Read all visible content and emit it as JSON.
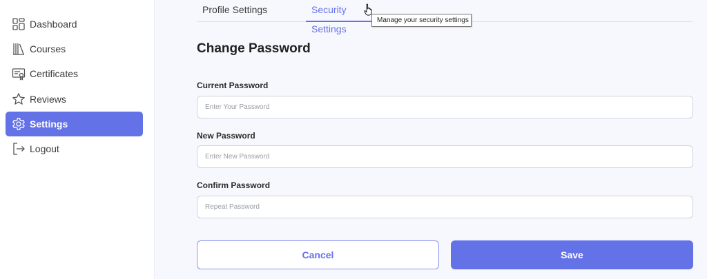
{
  "sidebar": {
    "items": [
      {
        "label": "Dashboard",
        "icon": "dashboard-icon",
        "active": false
      },
      {
        "label": "Courses",
        "icon": "books-icon",
        "active": false
      },
      {
        "label": "Certificates",
        "icon": "certificate-icon",
        "active": false
      },
      {
        "label": "Reviews",
        "icon": "star-icon",
        "active": false
      },
      {
        "label": "Settings",
        "icon": "gear-icon",
        "active": true
      },
      {
        "label": "Logout",
        "icon": "logout-icon",
        "active": false
      }
    ]
  },
  "tabs": [
    {
      "label": "Profile Settings",
      "active": false
    },
    {
      "label": "Security Settings",
      "active": true
    }
  ],
  "tooltip": "Manage your security settings",
  "form": {
    "title": "Change Password",
    "current_password": {
      "label": "Current Password",
      "placeholder": "Enter Your Password",
      "value": ""
    },
    "new_password": {
      "label": "New Password",
      "placeholder": "Enter New Password",
      "value": ""
    },
    "confirm_password": {
      "label": "Confirm Password",
      "placeholder": "Repeat Password",
      "value": ""
    }
  },
  "buttons": {
    "cancel": "Cancel",
    "save": "Save"
  },
  "colors": {
    "accent": "#6472e8",
    "background": "#f7f8fd",
    "sidebar": "#ffffff"
  }
}
